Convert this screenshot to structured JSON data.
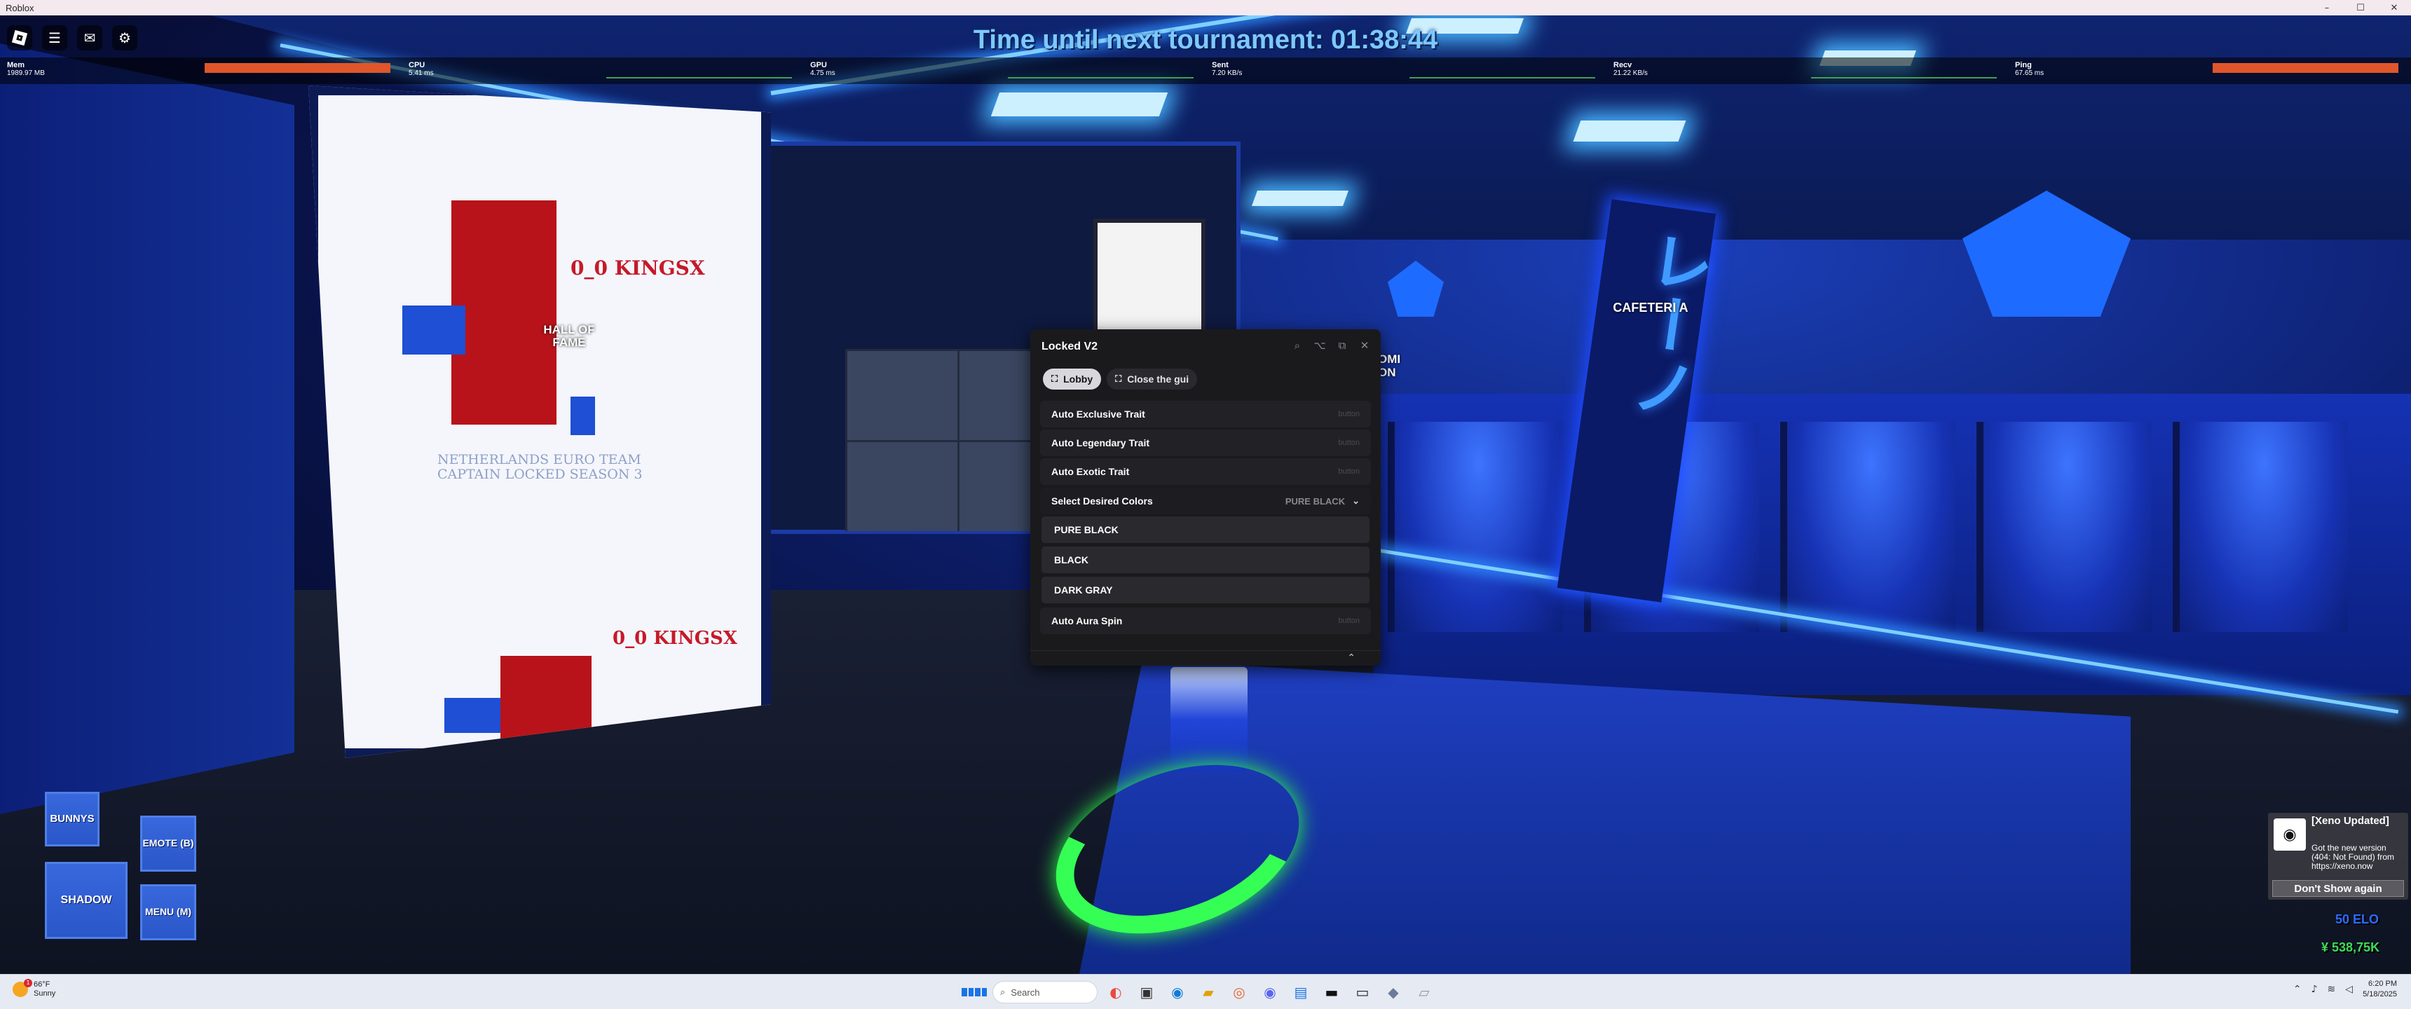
{
  "window": {
    "title": "Roblox",
    "controls": [
      "–",
      "☐",
      "✕"
    ]
  },
  "hud": {
    "timer_text": "Time until next tournament: 01:38:44",
    "toolbar_icons": [
      "roblox-logo-icon",
      "menu-icon",
      "chat-icon",
      "backpack-icon"
    ]
  },
  "stats": [
    {
      "name": "Mem",
      "value": "1989.97 MB"
    },
    {
      "name": "CPU",
      "value": "5.41 ms"
    },
    {
      "name": "GPU",
      "value": "4.75 ms"
    },
    {
      "name": "Sent",
      "value": "7.20 KB/s"
    },
    {
      "name": "Recv",
      "value": "21.22 KB/s"
    },
    {
      "name": "Ping",
      "value": "67.65 ms"
    }
  ],
  "scene": {
    "hall_of_fame": "HALL OF FAME",
    "cafeteria": "CAFETERI A",
    "domi_line1": "OMI",
    "domi_line2": "ON",
    "kingsx_top": "0_0 KINGSX",
    "kingsx_bottom": "0_0 KINGSX",
    "poster_text": "NETHERLANDS EURO TEAM CAPTAIN LOCKED SEASON 3"
  },
  "gui": {
    "title": "Locked V2",
    "header_icons": [
      "search-icon",
      "keybind-icon",
      "resize-icon",
      "close-icon"
    ],
    "tabs": [
      {
        "label": "Lobby",
        "active": true
      },
      {
        "label": "Close the gui",
        "active": false
      }
    ],
    "toggles": [
      {
        "label": "Auto Exclusive Trait",
        "button": "button"
      },
      {
        "label": "Auto Legendary Trait",
        "button": "button"
      },
      {
        "label": "Auto Exotic Trait",
        "button": "button"
      }
    ],
    "dropdown": {
      "label": "Select Desired Colors",
      "selected": "PURE BLACK",
      "options": [
        "PURE BLACK",
        "BLACK",
        "DARK GRAY"
      ]
    },
    "after": {
      "label": "Auto Aura Spin",
      "button": "button"
    }
  },
  "game_buttons": {
    "bunnys": "BUNNYS",
    "emote": "EMOTE (B)",
    "shadow": "SHADOW",
    "menu": "MENU (M)"
  },
  "notification": {
    "title": "[Xeno Updated]",
    "body": "Got the new version (404: Not Found) from https://xeno.now",
    "button": "Don't Show again"
  },
  "player": {
    "elo": "50 ELO",
    "currency": "¥ 538,75K"
  },
  "taskbar": {
    "weather_temp": "66°F",
    "weather_desc": "Sunny",
    "weather_badge": "1",
    "search_placeholder": "Search",
    "time": "6:20 PM",
    "date": "5/18/2025"
  }
}
